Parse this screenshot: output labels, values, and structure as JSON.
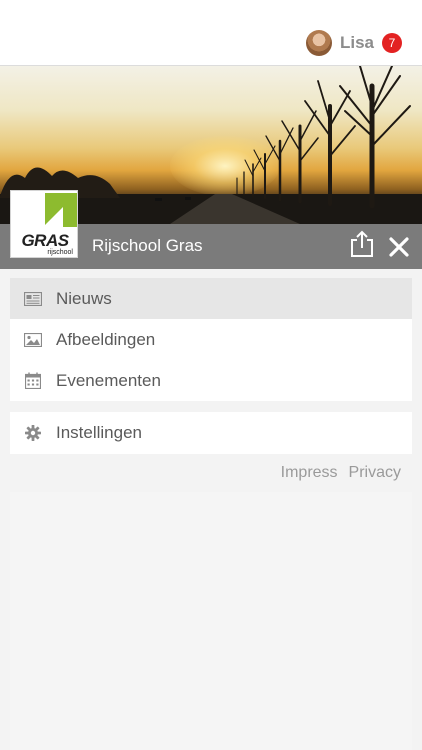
{
  "user": {
    "name": "Lisa",
    "notifications": "7"
  },
  "brand": {
    "logo_word": "GRAS",
    "logo_sub": "rijschool",
    "school_name": "Rijschool Gras",
    "accent": "#8dbb2f"
  },
  "menu": {
    "items": [
      {
        "label": "Nieuws",
        "icon": "newspaper-icon",
        "active": true
      },
      {
        "label": "Afbeeldingen",
        "icon": "image-icon",
        "active": false
      },
      {
        "label": "Evenementen",
        "icon": "calendar-icon",
        "active": false
      }
    ],
    "settings": {
      "label": "Instellingen",
      "icon": "gear-icon"
    }
  },
  "footer": {
    "impress": "Impress",
    "privacy": "Privacy"
  },
  "colors": {
    "title_bar": "#7b7b7b",
    "badge": "#e32222",
    "active_row": "#e6e6e6"
  }
}
